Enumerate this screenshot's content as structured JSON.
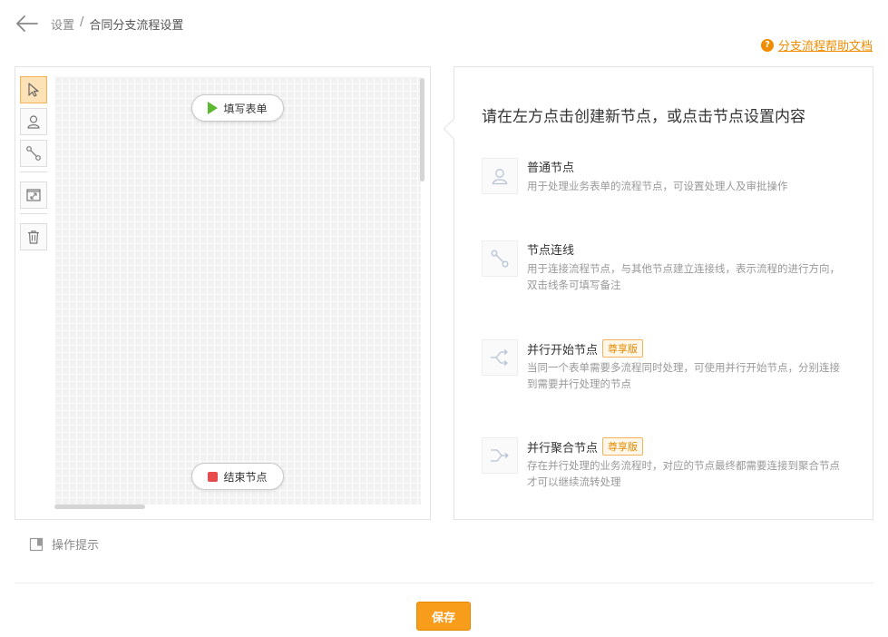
{
  "header": {
    "breadcrumb_root": "设置",
    "breadcrumb_sep": "/",
    "breadcrumb_current": "合同分支流程设置",
    "help_icon_text": "?",
    "help_link": "分支流程帮助文档"
  },
  "canvas": {
    "tools": [
      {
        "icon": "pointer-icon",
        "active": true
      },
      {
        "icon": "user-node-icon",
        "active": false
      },
      {
        "icon": "connector-icon",
        "active": false
      },
      {
        "icon": "fit-view-icon",
        "active": false
      },
      {
        "icon": "trash-icon",
        "active": false
      }
    ],
    "start_node": "填写表单",
    "end_node": "结束节点"
  },
  "info": {
    "title": "请在左方点击创建新节点，或点击节点设置内容",
    "items": [
      {
        "name": "普通节点",
        "badge": "",
        "desc": "用于处理业务表单的流程节点，可设置处理人及审批操作",
        "icon": "user-icon"
      },
      {
        "name": "节点连线",
        "badge": "",
        "desc": "用于连接流程节点，与其他节点建立连接线，表示流程的进行方向，双击线条可填写备注",
        "icon": "connector-icon"
      },
      {
        "name": "并行开始节点",
        "badge": "尊享版",
        "desc": "当同一个表单需要多流程同时处理，可使用并行开始节点，分别连接到需要并行处理的节点",
        "icon": "split-icon"
      },
      {
        "name": "并行聚合节点",
        "badge": "尊享版",
        "desc": "存在并行处理的业务流程时，对应的节点最终都需要连接到聚合节点才可以继续流转处理",
        "icon": "merge-icon"
      }
    ]
  },
  "hint": "操作提示",
  "save_label": "保存",
  "colors": {
    "accent": "#f89c1c",
    "start": "#5cb82f",
    "end": "#e84b4b"
  }
}
